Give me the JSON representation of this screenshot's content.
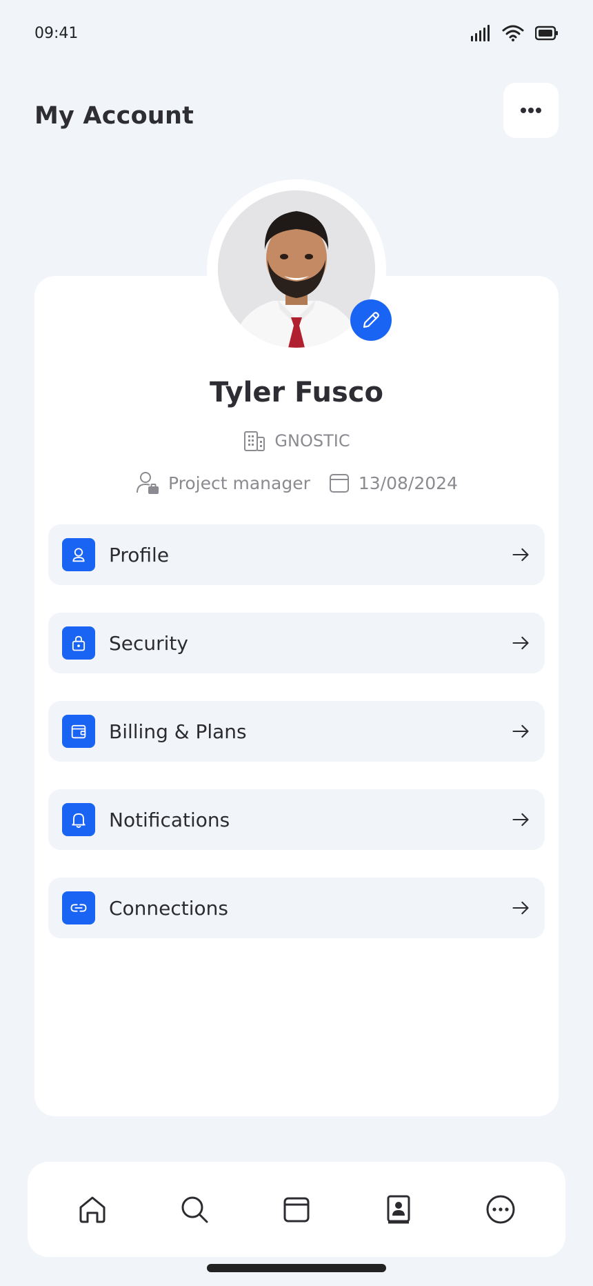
{
  "status_bar": {
    "time": "09:41"
  },
  "header": {
    "title": "My Account",
    "more_icon": "more-horizontal-icon"
  },
  "profile": {
    "name": "Tyler Fusco",
    "company": "GNOSTIC",
    "role": "Project manager",
    "date": "13/08/2024",
    "edit_icon": "pencil-icon"
  },
  "menu": [
    {
      "label": "Profile",
      "icon": "user-icon"
    },
    {
      "label": "Security",
      "icon": "lock-icon"
    },
    {
      "label": "Billing & Plans",
      "icon": "wallet-icon"
    },
    {
      "label": "Notifications",
      "icon": "bell-icon"
    },
    {
      "label": "Connections",
      "icon": "link-icon"
    }
  ],
  "bottom_nav": [
    {
      "icon": "home-icon"
    },
    {
      "icon": "search-icon"
    },
    {
      "icon": "calendar-icon"
    },
    {
      "icon": "contacts-icon"
    },
    {
      "icon": "more-circle-icon"
    }
  ],
  "colors": {
    "accent": "#1a64f3",
    "background": "#f1f4f9",
    "card": "#ffffff",
    "text": "#2b2b30",
    "muted": "#8a8a90"
  }
}
